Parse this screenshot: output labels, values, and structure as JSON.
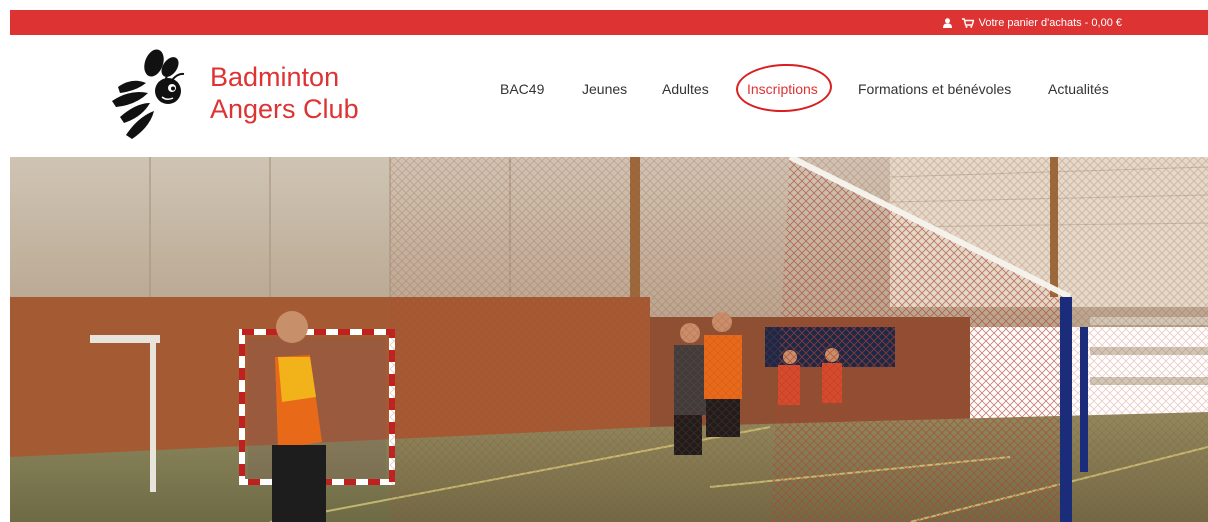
{
  "topbar": {
    "cart_label": "Votre panier d'achats - 0,00 €",
    "user_icon": "user-icon",
    "cart_icon": "shopping-cart-icon"
  },
  "brand": {
    "line1": "Badminton",
    "line2": "Angers Club",
    "logo_icon": "bee-logo"
  },
  "nav": {
    "items": [
      {
        "label": "BAC49"
      },
      {
        "label": "Jeunes"
      },
      {
        "label": "Adultes"
      },
      {
        "label": "Inscriptions",
        "active": true
      },
      {
        "label": "Formations et bénévoles"
      },
      {
        "label": "Actualités"
      }
    ]
  },
  "colors": {
    "accent": "#dd3333",
    "text": "#333333"
  }
}
